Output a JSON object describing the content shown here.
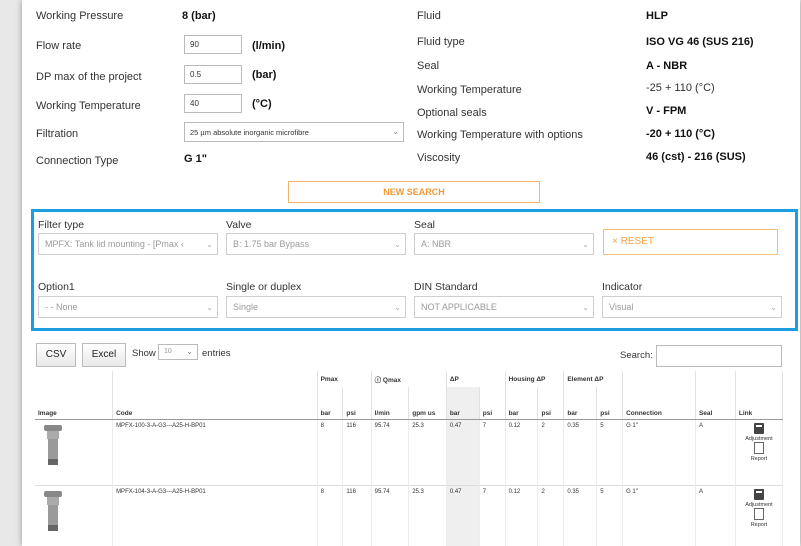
{
  "project": {
    "left": [
      {
        "label": "Working Pressure",
        "value": "8 (bar)",
        "unit": ""
      },
      {
        "label": "Flow rate",
        "value": "90",
        "unit": "(l/min)"
      },
      {
        "label": "DP max of the project",
        "value": "0.5",
        "unit": "(bar)"
      },
      {
        "label": "Working Temperature",
        "value": "40",
        "unit": "(°C)"
      },
      {
        "label": "Filtration",
        "value": "25 µm absolute inorganic microfibre",
        "unit": ""
      },
      {
        "label": "Connection Type",
        "value": "G 1\"",
        "unit": ""
      }
    ],
    "right": [
      {
        "label": "Fluid",
        "value": "HLP"
      },
      {
        "label": "Fluid type",
        "value": "ISO VG 46 (SUS 216)"
      },
      {
        "label": "Seal",
        "value": "A - NBR"
      },
      {
        "label": "Working Temperature",
        "value": "-25 + 110 (°C)"
      },
      {
        "label": "Optional seals",
        "value": "V - FPM"
      },
      {
        "label": "Working Temperature with options",
        "value": "-20 + 110 (°C)"
      },
      {
        "label": "Viscosity",
        "value": "46 (cst) - 216 (SUS)"
      }
    ]
  },
  "new_search_label": "NEW SEARCH",
  "filters": {
    "filter_type": {
      "label": "Filter type",
      "value": "MPFX: Tank lid mounting - [Pmax ‹"
    },
    "valve": {
      "label": "Valve",
      "value": "B: 1.75 bar Bypass"
    },
    "seal": {
      "label": "Seal",
      "value": "A: NBR"
    },
    "reset_label": "× RESET",
    "option1": {
      "label": "Option1",
      "value": "- - None"
    },
    "single_duplex": {
      "label": "Single or duplex",
      "value": "Single"
    },
    "din": {
      "label": "DIN Standard",
      "value": "NOT APPLICABLE"
    },
    "indicator": {
      "label": "Indicator",
      "value": "Visual"
    }
  },
  "toolbar": {
    "csv": "CSV",
    "excel": "Excel",
    "show": "Show",
    "entries_value": "10",
    "entries": "entries",
    "search_label": "Search:"
  },
  "table": {
    "group_headers": {
      "pmax": "Pmax",
      "qmax": "Qmax",
      "dp": "ΔP",
      "housing": "Housing ΔP",
      "element": "Element ΔP"
    },
    "headers": [
      "Image",
      "Code",
      "bar",
      "psi",
      "l/min",
      "gpm us",
      "bar",
      "psi",
      "bar",
      "psi",
      "bar",
      "psi",
      "Connection",
      "Seal",
      "Link"
    ],
    "rows": [
      {
        "code": "MPFX-100-3-A-G3---A25-H-BP01",
        "pmax_bar": "8",
        "pmax_psi": "116",
        "q_lmin": "95.74",
        "q_gpm": "25.3",
        "dp_bar": "0.47",
        "dp_psi": "7",
        "h_bar": "0.12",
        "h_psi": "2",
        "e_bar": "0.35",
        "e_psi": "5",
        "conn": "G 1\"",
        "seal": "A",
        "link1": "Adjustment",
        "link2": "Report"
      },
      {
        "code": "MPFX-104-3-A-G3---A25-H-BP01",
        "pmax_bar": "8",
        "pmax_psi": "116",
        "q_lmin": "95.74",
        "q_gpm": "25.3",
        "dp_bar": "0.47",
        "dp_psi": "7",
        "h_bar": "0.12",
        "h_psi": "2",
        "e_bar": "0.35",
        "e_psi": "5",
        "conn": "G 1\"",
        "seal": "A",
        "link1": "Adjustment",
        "link2": "Report"
      }
    ]
  }
}
